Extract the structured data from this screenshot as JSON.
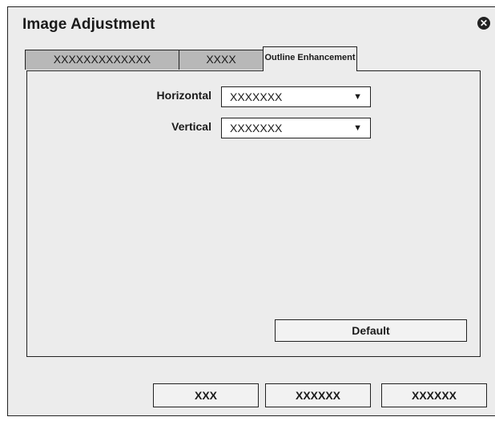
{
  "dialog": {
    "title": "Image Adjustment"
  },
  "icons": {
    "close": "close-circle-icon",
    "dropdown": "chevron-down-icon"
  },
  "tabs": [
    {
      "label": "XXXXXXXXXXXXX",
      "active": false
    },
    {
      "label": "XXXX",
      "active": false
    },
    {
      "label": "Outline Enhancement",
      "active": true
    }
  ],
  "outline": {
    "horizontal": {
      "label": "Horizontal",
      "value": "XXXXXXX"
    },
    "vertical": {
      "label": "Vertical",
      "value": "XXXXXXX"
    },
    "default_label": "Default"
  },
  "footer": {
    "button1": "XXX",
    "button2": "XXXXXX",
    "button3": "XXXXXX"
  }
}
